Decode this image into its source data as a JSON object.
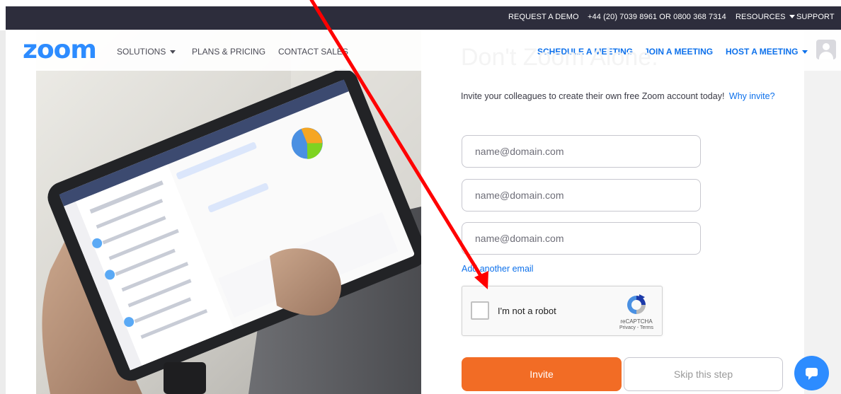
{
  "topbar": {
    "request_demo": "REQUEST A DEMO",
    "phone": "+44 (20) 7039 8961 OR 0800 368 7314",
    "resources": "RESOURCES",
    "support": "SUPPORT"
  },
  "header": {
    "logo": "zoom",
    "nav": {
      "solutions": "SOLUTIONS",
      "plans": "PLANS & PRICING",
      "contact": "CONTACT SALES",
      "schedule": "SCHEDULE A MEETING",
      "join": "JOIN A MEETING",
      "host": "HOST A MEETING"
    }
  },
  "hero": {
    "faded_heading": "Don't Zoom Alone."
  },
  "form": {
    "intro": "Invite your colleagues to create their own free Zoom account today!",
    "why_invite": "Why invite?",
    "email_placeholder": "name@domain.com",
    "add_email": "Add another email",
    "captcha": {
      "label": "I'm not a robot",
      "brand": "reCAPTCHA",
      "links": "Privacy - Terms"
    },
    "invite_button": "Invite",
    "skip_button": "Skip this step"
  },
  "colors": {
    "topbar_bg": "#2d2d3c",
    "brand_blue": "#2d8cff",
    "link_blue": "#0e71eb",
    "invite_orange": "#f26c25",
    "annotation_red": "#ff0000"
  }
}
